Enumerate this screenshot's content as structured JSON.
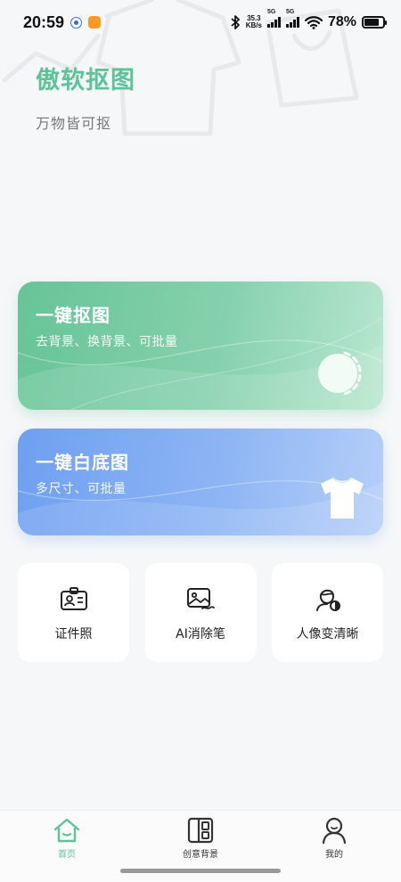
{
  "status_bar": {
    "time": "20:59",
    "net_speed_value": "35.3",
    "net_speed_unit": "KB/s",
    "signal_1_label": "5G",
    "signal_2_label": "5G",
    "battery_percent": "78%",
    "battery_level": 0.78
  },
  "header": {
    "title": "傲软抠图",
    "subtitle": "万物皆可抠"
  },
  "cards": {
    "cutout": {
      "title": "一键抠图",
      "desc": "去背景、换背景、可批量",
      "icon": "toggle-circle-icon"
    },
    "white_bg": {
      "title": "一键白底图",
      "desc": "多尺寸、可批量",
      "icon": "tshirt-icon"
    }
  },
  "tools": [
    {
      "label": "证件照",
      "icon": "id-card-icon"
    },
    {
      "label": "AI消除笔",
      "icon": "image-erase-icon"
    },
    {
      "label": "人像变清晰",
      "icon": "portrait-enhance-icon"
    }
  ],
  "bottom_nav": [
    {
      "label": "首页",
      "icon": "home-icon",
      "active": true
    },
    {
      "label": "创意背景",
      "icon": "layout-icon",
      "active": false
    },
    {
      "label": "我的",
      "icon": "person-icon",
      "active": false
    }
  ],
  "colors": {
    "accent_green": "#5cc39a",
    "card_green": "#67c497",
    "card_blue": "#6f9ff1",
    "background": "#f6f7f8"
  }
}
